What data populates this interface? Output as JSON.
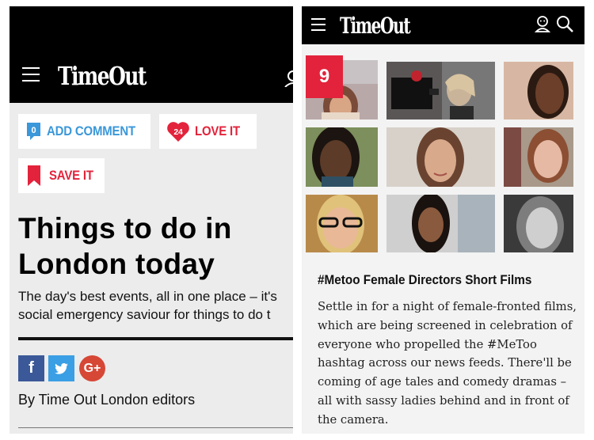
{
  "left": {
    "logo": "TimeOut",
    "buttons": {
      "comment_count": "0",
      "comment_label": "ADD COMMENT",
      "love_count": "24",
      "love_label": "LOVE IT",
      "save_label": "SAVE IT"
    },
    "title": "Things to do in London today",
    "subtitle": "The day's best events, all in one place – it's\nsocial emergency saviour for things to do t",
    "share": {
      "facebook": "f",
      "google_plus": "G+"
    },
    "byline": "By Time Out London editors"
  },
  "right": {
    "logo": "TimeOut",
    "rank_badge": "9",
    "film_title": "#Metoo Female Directors Short Films",
    "film_description": "Settle in for a night of female-fronted films, which are being screened in celebration of everyone who propelled the #MeToo hashtag across our news feeds. There'll be coming of age tales and comedy dramas – all with sassy ladies behind and in front of the camera.",
    "photo_grid": [
      {
        "icon": "portrait-photo"
      },
      {
        "icon": "camera-operator-photo"
      },
      {
        "icon": "portrait-photo"
      },
      {
        "icon": "portrait-photo"
      },
      {
        "icon": "portrait-photo"
      },
      {
        "icon": "portrait-photo"
      },
      {
        "icon": "portrait-photo"
      },
      {
        "icon": "portrait-photo"
      },
      {
        "icon": "portrait-photo"
      }
    ]
  },
  "colors": {
    "brand_red": "#e3233b",
    "comment_blue": "#3a97d9",
    "facebook": "#3b5998",
    "twitter": "#3a9fe4",
    "google_plus": "#d64736"
  }
}
